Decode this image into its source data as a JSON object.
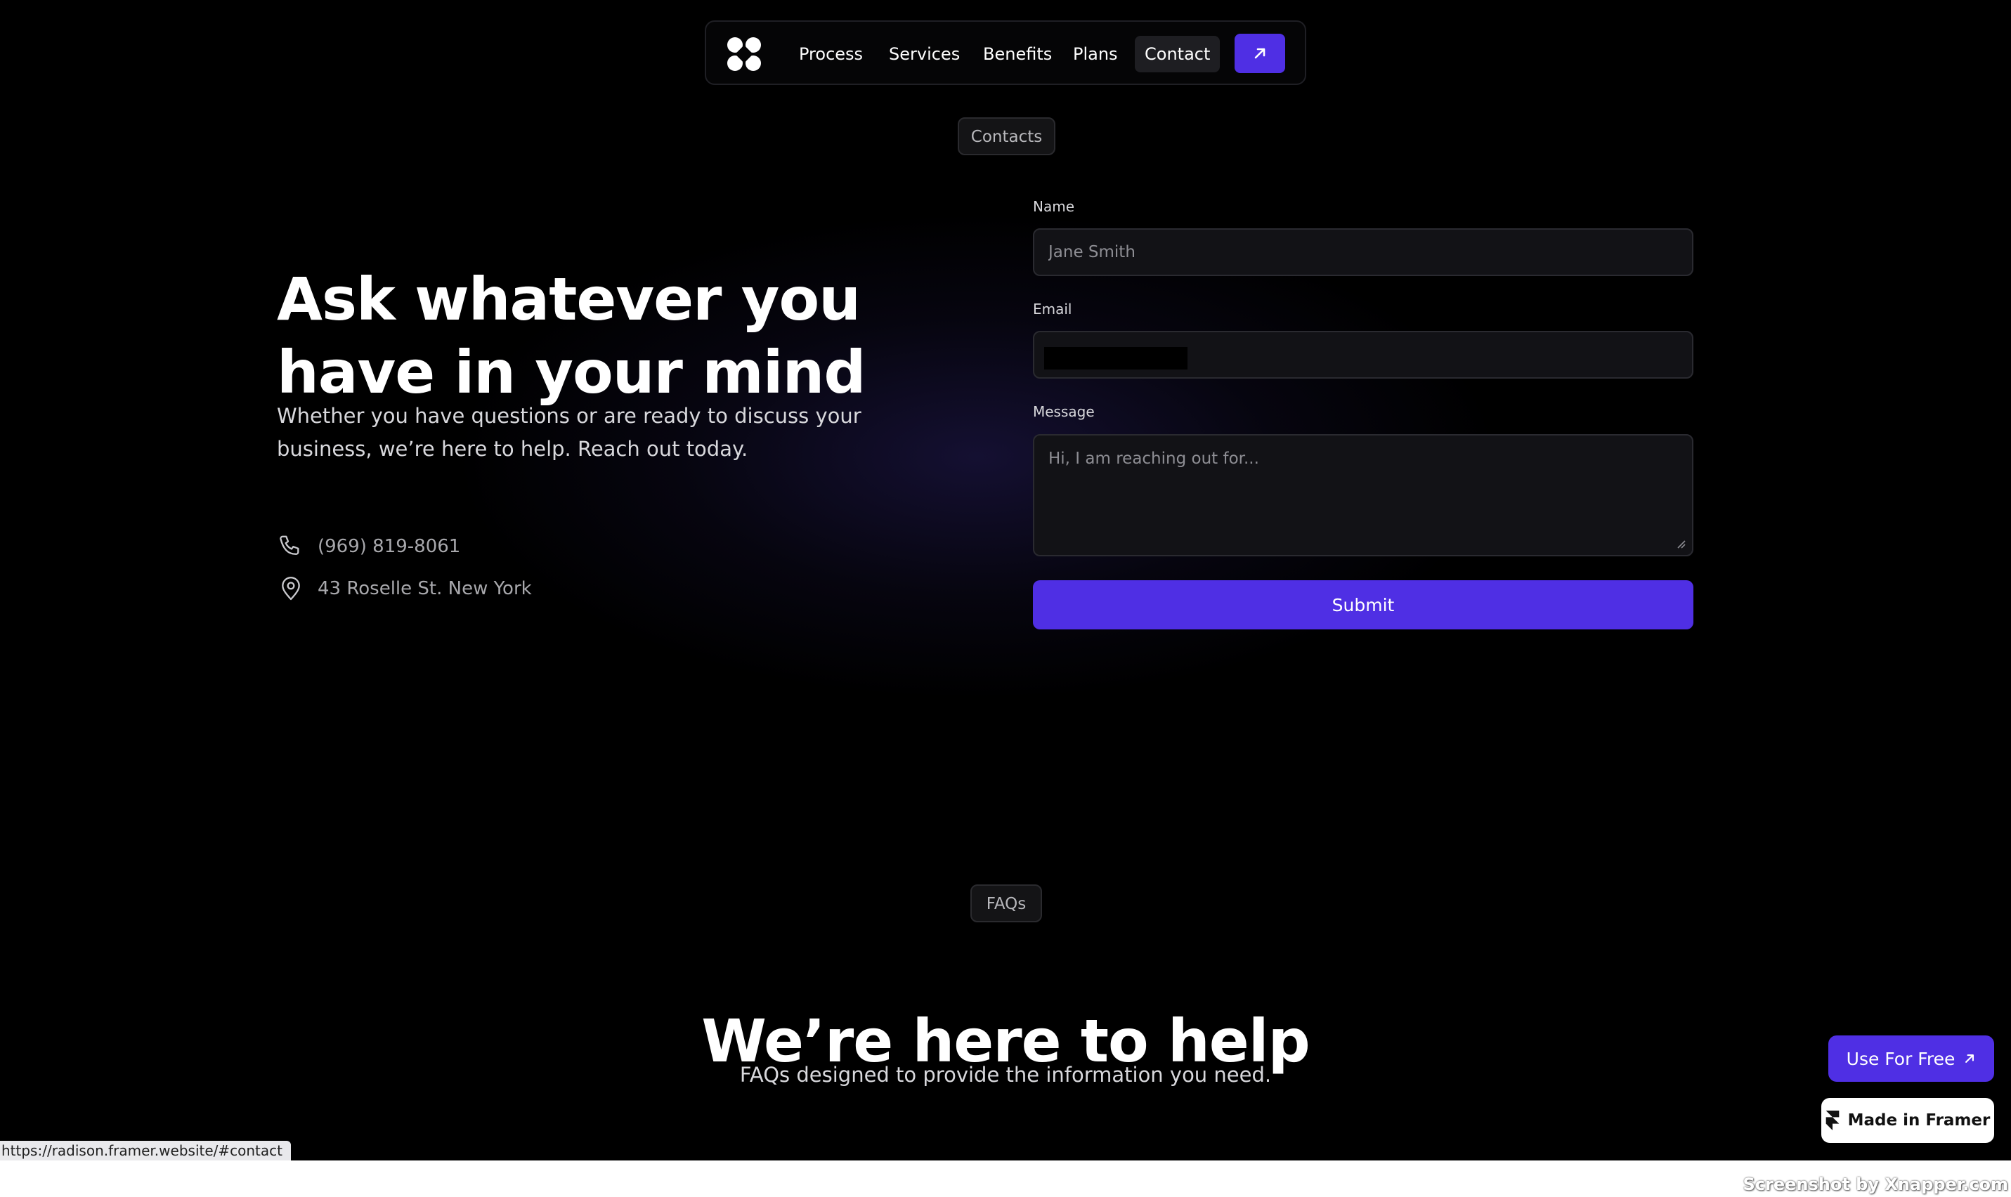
{
  "nav": {
    "items": [
      {
        "label": "Process"
      },
      {
        "label": "Services"
      },
      {
        "label": "Benefits"
      },
      {
        "label": "Plans"
      },
      {
        "label": "Contact",
        "active": true
      }
    ],
    "cta_icon": "arrow-up-right-icon"
  },
  "contact_section": {
    "pill": "Contacts",
    "title": "Ask whatever you have in your mind",
    "subtitle": "Whether you have questions or are ready to discuss your business, we’re here to help. Reach out today.",
    "phone": "(969) 819-8061",
    "address": "43 Roselle St. New York"
  },
  "form": {
    "name_label": "Name",
    "name_placeholder": "Jane Smith",
    "email_label": "Email",
    "email_placeholder": "",
    "message_label": "Message",
    "message_placeholder": "Hi, I am reaching out for...",
    "submit_label": "Submit"
  },
  "faq_section": {
    "pill": "FAQs",
    "title": "We’re here to help",
    "subtitle": "FAQs designed to provide the information you need."
  },
  "badges": {
    "use_free": "Use For Free",
    "made_in_framer": "Made in Framer"
  },
  "status_bar": {
    "url": "https://radison.framer.website/#contact"
  },
  "watermark": "Screenshot by Xnapper.com",
  "colors": {
    "background": "#000000",
    "accent": "#4f2fe4",
    "field_bg": "#121216"
  }
}
